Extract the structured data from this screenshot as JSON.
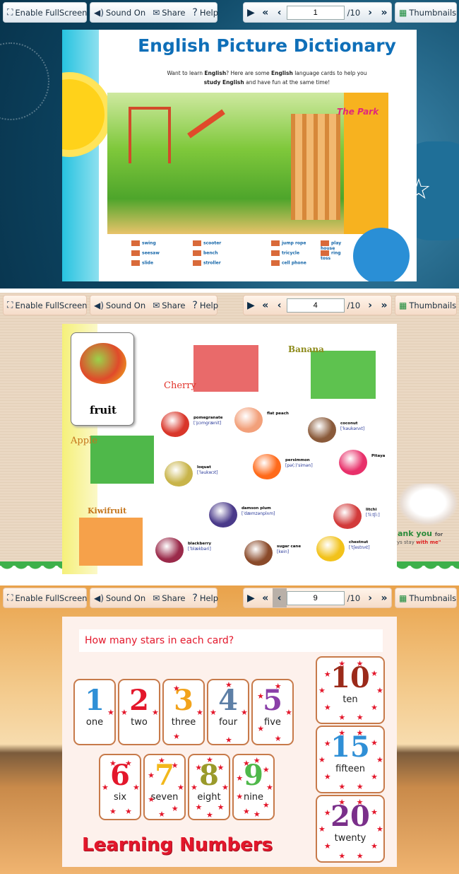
{
  "toolbar": {
    "fullscreen": "Enable FullScreen",
    "sound": "Sound On",
    "share": "Share",
    "help": "Help",
    "thumbnails": "Thumbnails",
    "total": "/10"
  },
  "icons": {
    "fullscreen": "fullscreen-icon",
    "sound": "speaker-icon",
    "share": "envelope-icon",
    "help": "question-icon",
    "play": "play-icon",
    "first": "double-chevron-left-icon",
    "prev": "chevron-left-icon",
    "next": "chevron-right-icon",
    "last": "double-chevron-right-icon",
    "thumbnails": "grid-icon"
  },
  "viewers": [
    {
      "page": "1",
      "theme": "blue"
    },
    {
      "page": "4",
      "theme": "peach"
    },
    {
      "page": "9",
      "theme": "sunset",
      "prev_active": true
    }
  ],
  "page1": {
    "title": "English Picture Dictionary",
    "intro_line1_a": "Want to learn ",
    "intro_bold1": "English",
    "intro_line1_b": "? Here are some ",
    "intro_bold2": "English",
    "intro_line1_c": " language cards to help you",
    "intro_bold3": "study English",
    "intro_line2": " and have fun at the same time!",
    "scene_label": "The Park",
    "vocab": [
      [
        "swing",
        "seesaw",
        "slide"
      ],
      [
        "scooter",
        "bench",
        "stroller"
      ],
      [
        "jump rope",
        "tricycle",
        "cell phone"
      ],
      [
        "play house",
        "ring toss"
      ]
    ]
  },
  "page4": {
    "card_word": "fruit",
    "labels": {
      "banana": "Banana",
      "cherry": "Cherry",
      "apple": "Apple",
      "kiwifruit": "Kiwifruit"
    },
    "fruits": [
      {
        "name": "pomegranate",
        "ipa": "[ˈpɔmgrænit]"
      },
      {
        "name": "flat peach",
        "ipa": ""
      },
      {
        "name": "coconut",
        "ipa": "[ˈkəukənʌt]"
      },
      {
        "name": "loquat",
        "ipa": "[ˈləukwɔt]"
      },
      {
        "name": "persimmon",
        "ipa": "[pə(ː)ˈsimən]"
      },
      {
        "name": "Pitaya",
        "ipa": ""
      },
      {
        "name": "damson plum",
        "ipa": "[ˈdæmzənplʌm]"
      },
      {
        "name": "litchi",
        "ipa": "[ˈliːtʃiː]"
      },
      {
        "name": "blackberry",
        "ipa": "[ˈblækbəri]"
      },
      {
        "name": "sugar cane",
        "ipa": "[kein]"
      },
      {
        "name": "chestnut",
        "ipa": "[ˈtʃestnʌt]"
      }
    ],
    "side_text1": "ank you",
    "side_text2": "for",
    "side_text3": "ys stay",
    "side_text4": "with me\""
  },
  "page9": {
    "question": "How many stars in each card?",
    "title": "Learning Numbers",
    "cards": [
      {
        "n": "1",
        "w": "one",
        "c": "#2f8fd6"
      },
      {
        "n": "2",
        "w": "two",
        "c": "#e3172b"
      },
      {
        "n": "3",
        "w": "three",
        "c": "#f2a31b"
      },
      {
        "n": "4",
        "w": "four",
        "c": "#5d7fa6"
      },
      {
        "n": "5",
        "w": "five",
        "c": "#8a3fa8"
      },
      {
        "n": "6",
        "w": "six",
        "c": "#e3172b"
      },
      {
        "n": "7",
        "w": "seven",
        "c": "#f2b81b"
      },
      {
        "n": "8",
        "w": "eight",
        "c": "#9a9a2a"
      },
      {
        "n": "9",
        "w": "nine",
        "c": "#4fb84a"
      },
      {
        "n": "10",
        "w": "ten",
        "c": "#9b2a1a"
      },
      {
        "n": "15",
        "w": "fifteen",
        "c": "#2f8fd6"
      },
      {
        "n": "20",
        "w": "twenty",
        "c": "#7a2f8a"
      }
    ]
  }
}
